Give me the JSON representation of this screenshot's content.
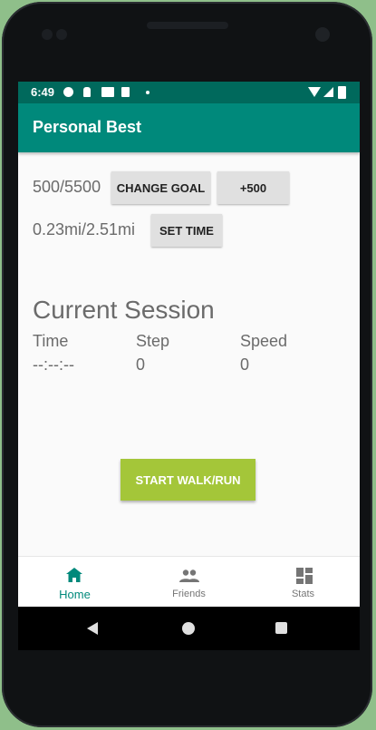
{
  "status_bar": {
    "time": "6:49",
    "icons": [
      "gear-icon",
      "pin-icon",
      "mail-icon",
      "sd-card-icon",
      "dot-icon",
      "wifi-icon",
      "signal-icon",
      "battery-icon"
    ]
  },
  "app_bar": {
    "title": "Personal Best"
  },
  "goal": {
    "steps_progress": "500/5500",
    "change_goal_label": "CHANGE GOAL",
    "add_label": "+500"
  },
  "distance": {
    "progress": "0.23mi/2.51mi",
    "set_time_label": "SET TIME"
  },
  "session": {
    "title": "Current Session",
    "columns": [
      {
        "label": "Time",
        "value": "--:--:--"
      },
      {
        "label": "Step",
        "value": "0"
      },
      {
        "label": "Speed",
        "value": "0"
      }
    ]
  },
  "start_button": {
    "label": "START WALK/RUN"
  },
  "bottom_nav": {
    "items": [
      {
        "label": "Home",
        "icon": "home-icon",
        "active": true
      },
      {
        "label": "Friends",
        "icon": "people-icon",
        "active": false
      },
      {
        "label": "Stats",
        "icon": "dashboard-icon",
        "active": false
      }
    ]
  },
  "colors": {
    "status_bar": "#00695c",
    "app_bar": "#00897b",
    "accent": "#00897b",
    "start_button": "#a4c639",
    "button_gray": "#e0e0e0"
  }
}
